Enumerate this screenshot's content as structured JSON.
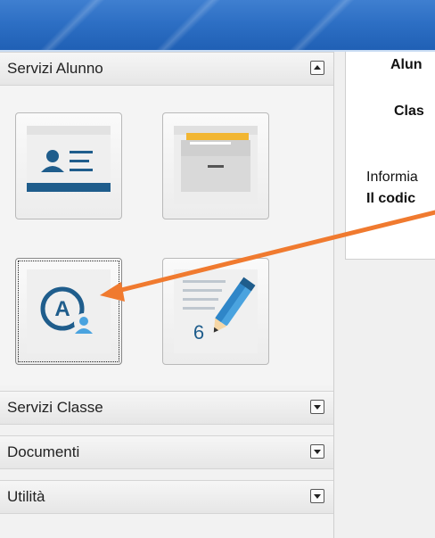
{
  "sidebar": {
    "sections": [
      {
        "label": "Servizi Alunno",
        "state": "expanded"
      },
      {
        "label": "Servizi Classe",
        "state": "collapsed"
      },
      {
        "label": "Documenti",
        "state": "collapsed"
      },
      {
        "label": "Utilità",
        "state": "collapsed"
      }
    ],
    "tiles": [
      {
        "icon": "student-card-icon"
      },
      {
        "icon": "folder-drawer-icon"
      },
      {
        "icon": "alumni-a-user-icon",
        "selected": true
      },
      {
        "icon": "grade-pencil-icon",
        "number": "6"
      }
    ]
  },
  "right": {
    "label_alunno": "Alun",
    "label_classe": "Clas",
    "info_text": "Informia",
    "code_text": "Il codic"
  },
  "colors": {
    "header_blue": "#2d6fc4",
    "arrow": "#f07a2f",
    "icon_blue": "#1f5d8c",
    "icon_blue_light": "#4aa3df"
  }
}
